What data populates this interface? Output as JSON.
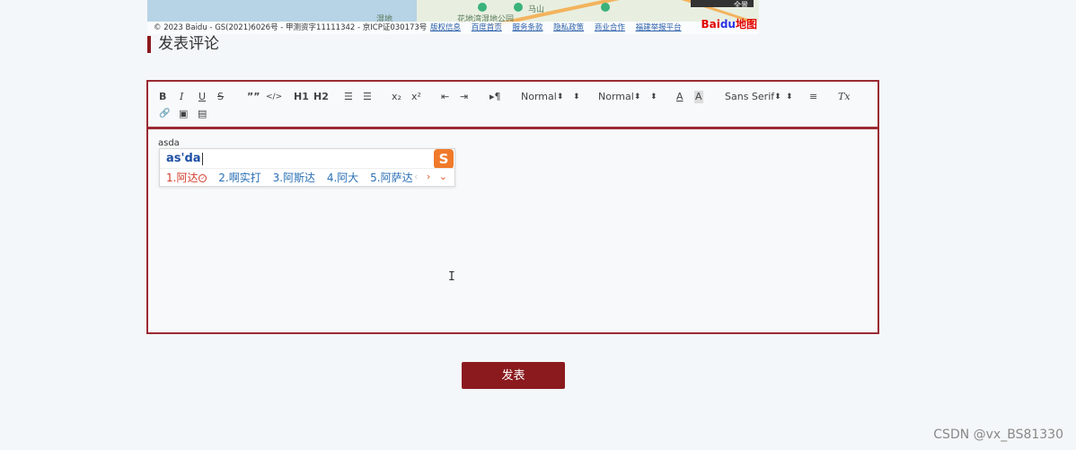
{
  "map": {
    "copyright": "© 2023 Baidu - GS(2021)6026号 - 甲测资字11111342 - 京ICP证030173号",
    "links": [
      "版权信息",
      "百度首页",
      "服务条款",
      "隐私政策",
      "商业合作",
      "福建举报平台"
    ],
    "places": [
      "湿地",
      "马山",
      "花地湾湿地公园"
    ],
    "logo_text": "Bai",
    "logo_paw": "du",
    "logo_suffix": "地图",
    "thumb_label": "全景"
  },
  "section": {
    "title": "发表评论"
  },
  "toolbar": {
    "bold": "B",
    "italic": "I",
    "underline": "U",
    "strike": "S",
    "blockquote": "””",
    "code": "</>",
    "h1": "H1",
    "h2": "H2",
    "ordered_list": "☰",
    "bullet_list": "☰",
    "subscript": "x₂",
    "superscript": "x²",
    "outdent": "⇤",
    "indent": "⇥",
    "direction": "▸¶",
    "size_select": "Normal",
    "header_select": "Normal",
    "font_color": "A",
    "background": "A",
    "font_select": "Sans Serif",
    "align": "≡",
    "clean": "Tx",
    "link": "🔗",
    "image": "▣",
    "video": "▤"
  },
  "editor": {
    "typed_text": "asda"
  },
  "ime": {
    "composition": "as'da",
    "candidates": [
      "1.阿达",
      "2.啊实打",
      "3.阿斯达",
      "4.阿大",
      "5.阿萨达"
    ],
    "prev": "‹",
    "next": "›",
    "more": "⌄",
    "logo": "S"
  },
  "submit": {
    "label": "发表"
  },
  "watermark": "CSDN @vx_BS81330"
}
